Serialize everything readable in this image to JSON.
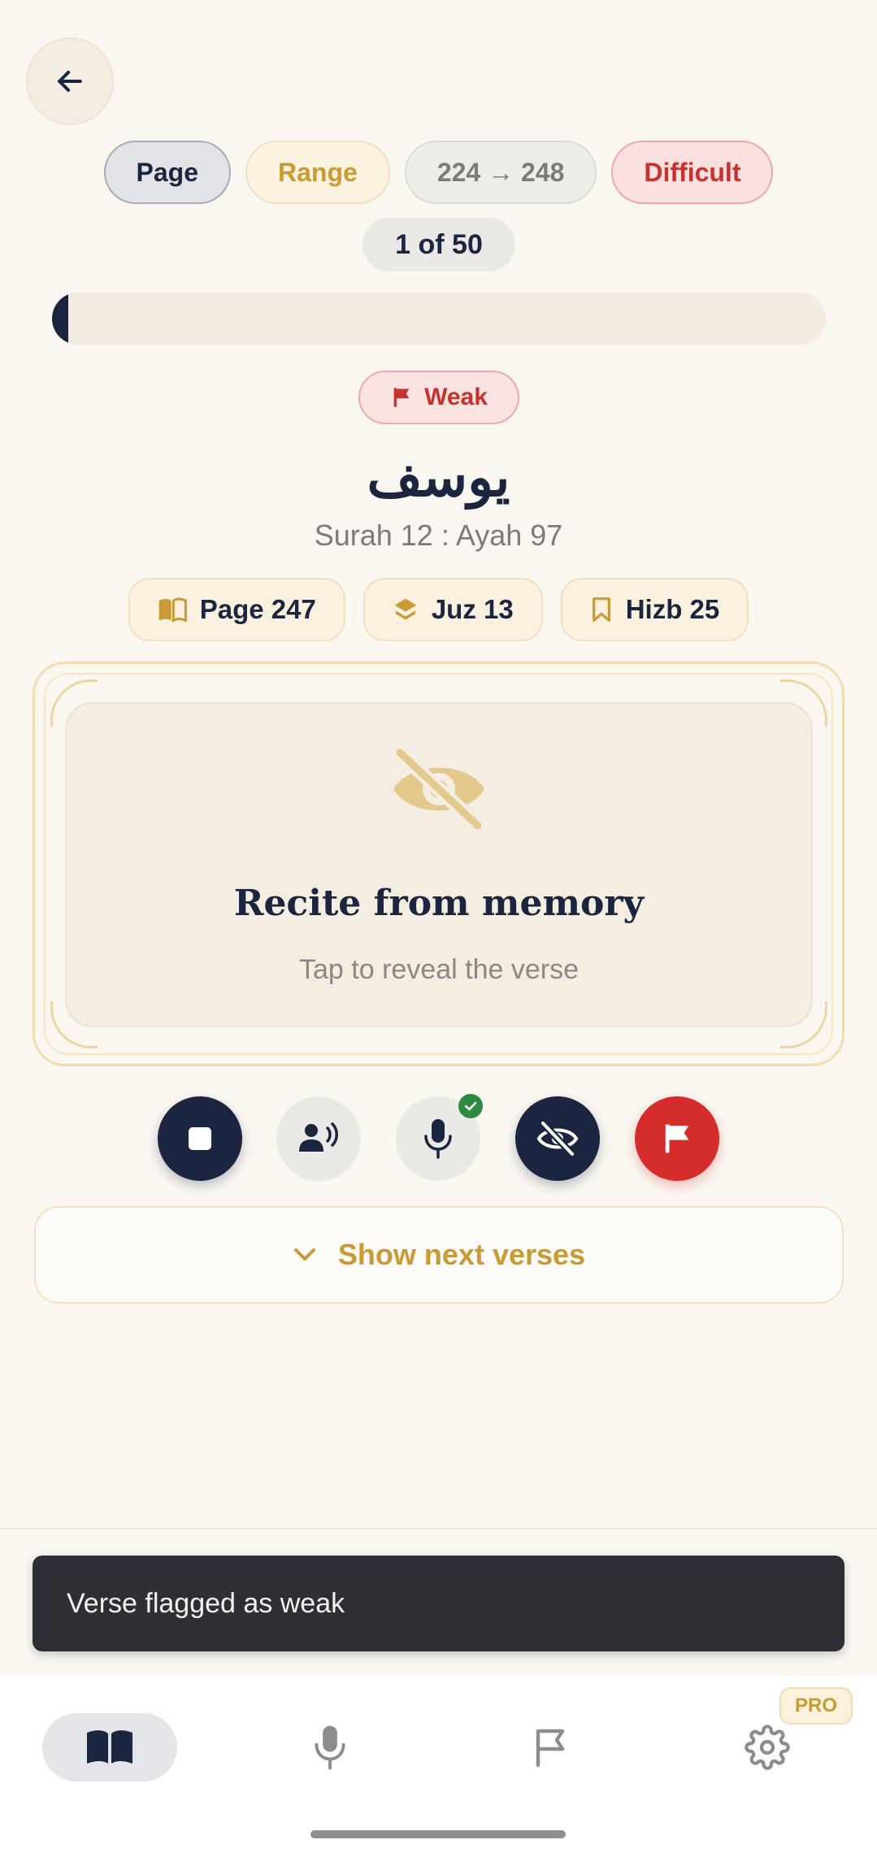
{
  "header": {
    "back_icon": "arrow-left-icon"
  },
  "filters": {
    "page_label": "Page",
    "range_label": "Range",
    "range_value": "224 → 248",
    "difficult_label": "Difficult"
  },
  "progress": {
    "counter": "1 of 50",
    "current": 1,
    "total": 50
  },
  "verse": {
    "status_badge": "Weak",
    "surah_name_ar": "يوسف",
    "reference": "Surah 12 : Ayah 97",
    "page_label": "Page 247",
    "juz_label": "Juz 13",
    "hizb_label": "Hizb 25"
  },
  "card": {
    "title": "Recite from memory",
    "subtitle": "Tap to reveal the verse",
    "icon": "eye-off-icon"
  },
  "actions": {
    "stop_icon": "stop-icon",
    "listen_icon": "speaker-person-icon",
    "mic_icon": "microphone-icon",
    "hide_icon": "eye-off-icon",
    "flag_icon": "flag-icon"
  },
  "next_verses_label": "Show next verses",
  "toast": "Verse flagged as weak",
  "nav": {
    "items": [
      "book-open-icon",
      "microphone-icon",
      "flag-icon",
      "settings-icon"
    ],
    "pro_badge": "PRO"
  },
  "colors": {
    "navy": "#1b2540",
    "gold": "#c99a35",
    "red": "#d52d2c",
    "background": "#faf7f1"
  }
}
